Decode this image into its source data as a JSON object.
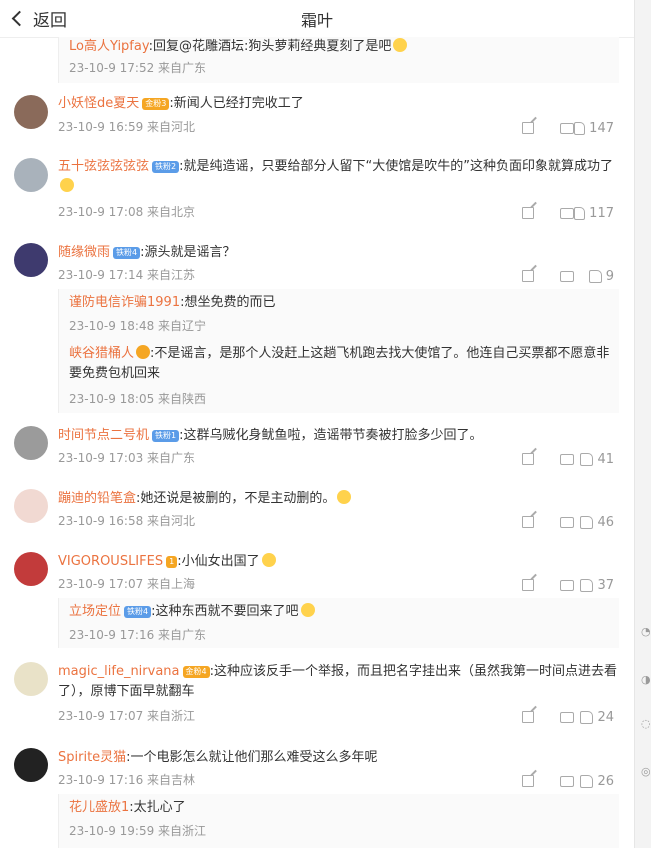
{
  "header": {
    "back_label": "返回",
    "title": "霜叶"
  },
  "top_reply": {
    "user": "Lo高人Yipfay",
    "text": ":回复@花雕酒坛:狗头萝莉经典夏刻了是吧",
    "meta": "23-10-9 17:52 来自广东"
  },
  "comments": [
    {
      "user": "小妖怪de夏天",
      "badge": "金粉3",
      "badge_color": "#f5a623",
      "text": ":新闻人已经打完收工了",
      "meta": "23-10-9 16:59 来自河北",
      "likes": "147",
      "av_color": "#8a6a5a"
    },
    {
      "user": "五十弦弦弦弦弦",
      "badge": "铁粉2",
      "badge_color": "#5b9ce8",
      "text": ":就是纯造谣，只要给部分人留下“大使馆是吹牛的”这种负面印象就算成功了",
      "meta": "23-10-9 17:08 来自北京",
      "likes": "117",
      "av_color": "#a9b2bb"
    },
    {
      "user": "随缘微雨",
      "badge": "铁粉4",
      "badge_color": "#5b9ce8",
      "text": ":源头就是谣言？",
      "meta": "23-10-9 17:14 来自江苏",
      "likes": "9",
      "av_color": "#3e3a6e"
    },
    {
      "user": "时间节点二号机",
      "badge": "铁粉1",
      "badge_color": "#5b9ce8",
      "text": ":这群乌贼化身鱿鱼啦，造谣带节奏被打脸多少回了。",
      "meta": "23-10-9 17:03 来自广东",
      "likes": "41",
      "av_color": "#9b9b9b"
    },
    {
      "user": "蹦迪的铅笔盒",
      "badge": "",
      "badge_color": "",
      "text": ":她还说是被删的，不是主动删的。",
      "meta": "23-10-9 16:58 来自河北",
      "likes": "46",
      "av_color": "#f1d9d2"
    },
    {
      "user": "VIGOROUSLIFES",
      "badge": "1",
      "badge_color": "#f5a623",
      "text": ":小仙女出国了",
      "meta": "23-10-9 17:07 来自上海",
      "likes": "37",
      "av_color": "#c23b3b"
    },
    {
      "user": "magic_life_nirvana",
      "badge": "金粉4",
      "badge_color": "#f5a623",
      "text": ":这种应该反手一个举报，而且把名字挂出来（虽然我第一时间点进去看了），原博下面早就翻车",
      "meta": "23-10-9 17:07 来自浙江",
      "likes": "24",
      "av_color": "#e9e2c8"
    },
    {
      "user": "Spirite灵猫",
      "badge": "",
      "badge_color": "",
      "text": ":一个电影怎么就让他们那么难受这么多年呢",
      "meta": "23-10-9 17:16 来自吉林",
      "likes": "26",
      "av_color": "#222222"
    }
  ],
  "replies": {
    "r3a": {
      "user": "谨防电信诈骗1991",
      "text": ":想坐免费的而已",
      "meta": "23-10-9 18:48 来自辽宁"
    },
    "r3b": {
      "user": "峡谷猎桶人",
      "text": ":不是谣言，是那个人没赶上这趟飞机跑去找大使馆了。他连自己买票都不愿意非要免费包机回来",
      "meta": "23-10-9 18:05 来自陕西"
    },
    "r6a": {
      "user": "立场定位",
      "badge": "铁粉4",
      "text": ":这种东西就不要回来了吧",
      "meta": "23-10-9 17:16 来自广东"
    },
    "r8a": {
      "user": "花儿盛放1",
      "text": ":太扎心了",
      "meta": "23-10-9 19:59 来自浙江"
    }
  }
}
